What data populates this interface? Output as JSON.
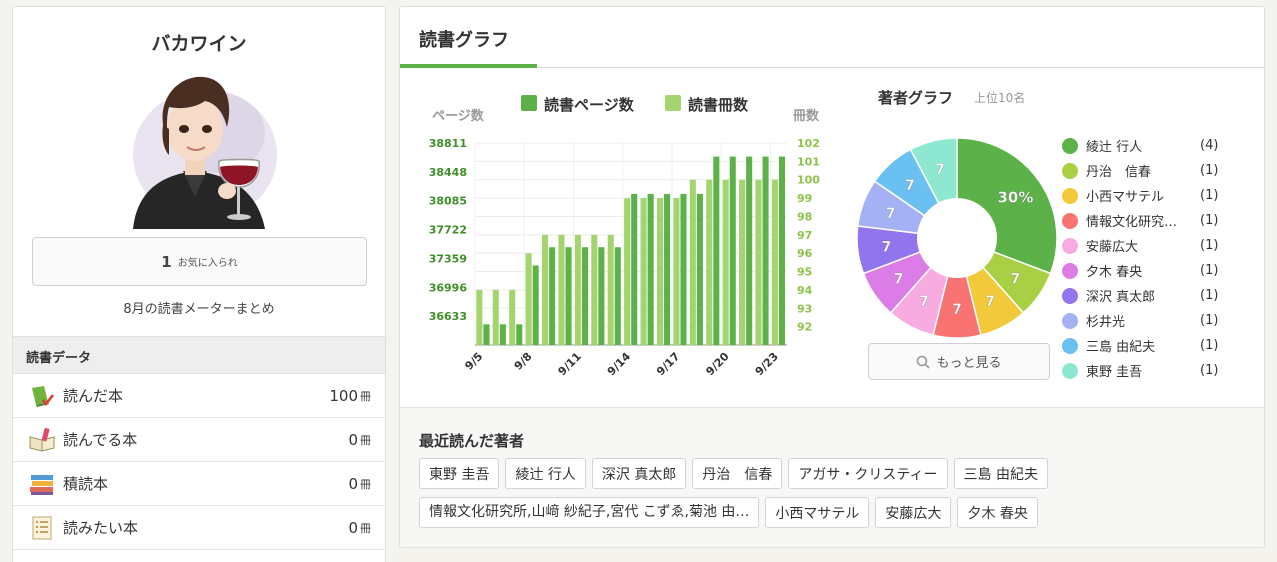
{
  "profile": {
    "name": "バカワイン",
    "favorites_count": "1",
    "favorites_label": "お気に入られ",
    "summary_link": "8月の読書メーターまとめ"
  },
  "reading_data": {
    "header": "読書データ",
    "items": [
      {
        "label": "読んだ本",
        "count": "100",
        "unit": "冊",
        "icon": "read-book-icon"
      },
      {
        "label": "読んでる本",
        "count": "0",
        "unit": "冊",
        "icon": "reading-book-icon"
      },
      {
        "label": "積読本",
        "count": "0",
        "unit": "冊",
        "icon": "stacked-books-icon"
      },
      {
        "label": "読みたい本",
        "count": "0",
        "unit": "冊",
        "icon": "wish-list-icon"
      }
    ]
  },
  "tab": {
    "title": "読書グラフ"
  },
  "chart_data": {
    "type": "bar",
    "title": "",
    "ylabel_left": "ページ数",
    "ylabel_right": "冊数",
    "categories": [
      "9/5",
      "9/6",
      "9/7",
      "9/8",
      "9/9",
      "9/10",
      "9/11",
      "9/12",
      "9/13",
      "9/14",
      "9/15",
      "9/16",
      "9/17",
      "9/18",
      "9/19",
      "9/20",
      "9/21",
      "9/22",
      "9/23"
    ],
    "x_tick_labels": [
      "9/5",
      "9/8",
      "9/11",
      "9/14",
      "9/17",
      "9/20",
      "9/23"
    ],
    "left_ticks": [
      "38811",
      "38448",
      "38085",
      "37722",
      "37359",
      "36996",
      "36633"
    ],
    "right_ticks": [
      "102",
      "101",
      "100",
      "99",
      "98",
      "97",
      "96",
      "95",
      "94",
      "93",
      "92"
    ],
    "ylim_left": [
      36270,
      38811
    ],
    "ylim_right": [
      91,
      102
    ],
    "legend_placement": "top",
    "series": [
      {
        "name": "読書ページ数",
        "axis": "left",
        "color": "#5cb249",
        "values": [
          36530,
          36530,
          36530,
          37270,
          37500,
          37500,
          37500,
          37500,
          37500,
          38170,
          38170,
          38170,
          38170,
          38170,
          38640,
          38640,
          38640,
          38640,
          38640
        ]
      },
      {
        "name": "読書冊数",
        "axis": "right",
        "color": "#a3d46e",
        "values": [
          94,
          94,
          94,
          96,
          97,
          97,
          97,
          97,
          97,
          99,
          99,
          99,
          99,
          100,
          100,
          100,
          100,
          100,
          100
        ]
      }
    ]
  },
  "author_graph": {
    "title": "著者グラフ",
    "subtitle": "上位10名",
    "center_label": "30%",
    "more_button": "もっと見る",
    "authors": [
      {
        "name": "綾辻 行人",
        "count_label": "(4)",
        "value": 4,
        "slice_label": "30%",
        "color": "#5cb249"
      },
      {
        "name": "丹治　信春",
        "count_label": "(1)",
        "value": 1,
        "slice_label": "7",
        "color": "#a9cf45"
      },
      {
        "name": "小西マサテル",
        "count_label": "(1)",
        "value": 1,
        "slice_label": "7",
        "color": "#f2c93b"
      },
      {
        "name": "情報文化研究所,山﨑 紗紀子,宮代 こずゑ,菊池 由…",
        "count_label": "(1)",
        "value": 1,
        "slice_label": "7",
        "color": "#f97373"
      },
      {
        "name": "安藤広大",
        "count_label": "(1)",
        "value": 1,
        "slice_label": "7",
        "color": "#f8abe0"
      },
      {
        "name": "夕木 春央",
        "count_label": "(1)",
        "value": 1,
        "slice_label": "7",
        "color": "#dc7ce6"
      },
      {
        "name": "深沢 真太郎",
        "count_label": "(1)",
        "value": 1,
        "slice_label": "7",
        "color": "#9175ee"
      },
      {
        "name": "杉井光",
        "count_label": "(1)",
        "value": 1,
        "slice_label": "7",
        "color": "#a5b1f5"
      },
      {
        "name": "三島 由紀夫",
        "count_label": "(1)",
        "value": 1,
        "slice_label": "7",
        "color": "#6bc0f2"
      },
      {
        "name": "東野 圭吾",
        "count_label": "(1)",
        "value": 1,
        "slice_label": "7",
        "color": "#8ee8cf"
      }
    ]
  },
  "recent_authors": {
    "title": "最近読んだ著者",
    "row1": [
      "東野 圭吾",
      "綾辻 行人",
      "深沢 真太郎",
      "丹治　信春",
      "アガサ・クリスティー",
      "三島 由紀夫"
    ],
    "row2": [
      "情報文化研究所,山﨑 紗紀子,宮代 こずゑ,菊池 由…",
      "小西マサテル",
      "安藤広大",
      "夕木 春央"
    ]
  },
  "colors": {
    "accent": "#5cb249",
    "accent_light": "#a3d46e"
  }
}
